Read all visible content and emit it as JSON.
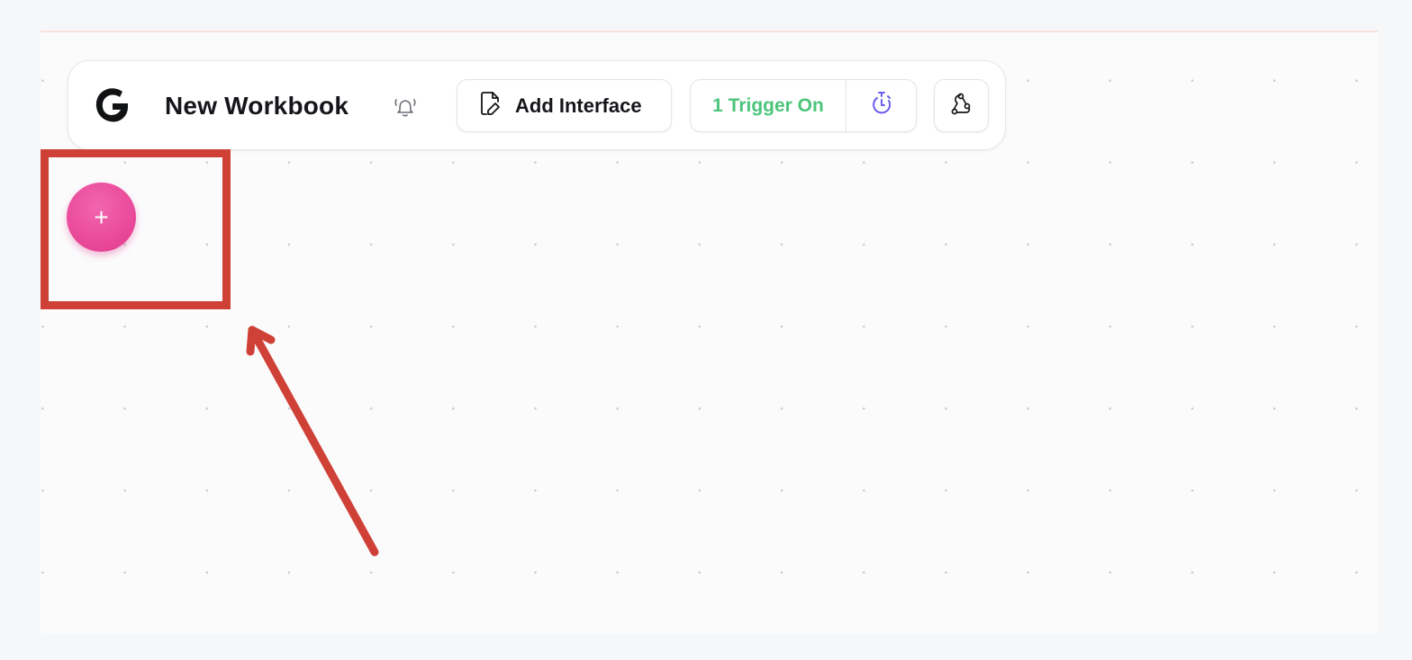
{
  "workbook": {
    "title": "New Workbook"
  },
  "toolbar": {
    "add_interface_label": "Add Interface",
    "trigger_label": "1 Trigger On"
  },
  "fab": {
    "label": "+"
  },
  "colors": {
    "fab": "#e84596",
    "trigger_text": "#4cc47a",
    "timer_icon": "#6b5cf0",
    "annotation": "#cf4136"
  },
  "icons": {
    "logo": "g-logo-icon",
    "notification": "bell-icon",
    "interface": "file-pen-icon",
    "timer": "timer-icon",
    "webhook": "webhook-icon"
  }
}
